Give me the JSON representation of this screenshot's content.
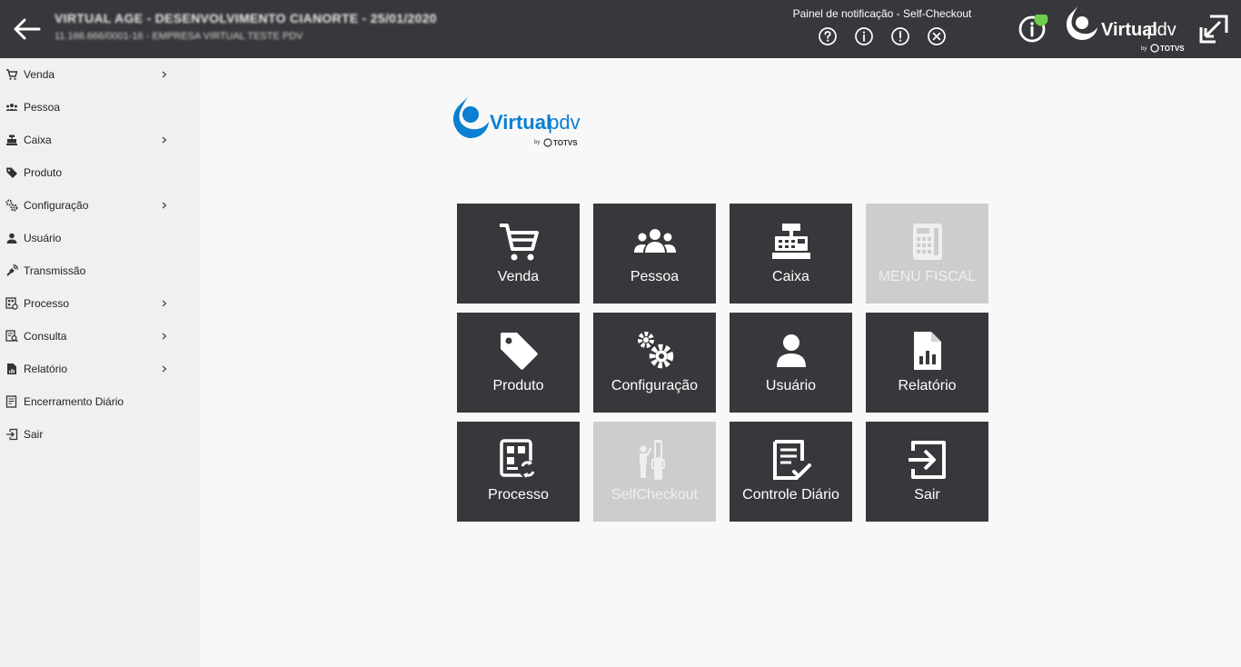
{
  "header": {
    "back_icon": "arrow-left-icon",
    "title": "VIRTUAL AGE - DESENVOLVIMENTO CIANORTE - 25/01/2020",
    "subtitle": "11.166.666/0001-16 - EMPRESA VIRTUAL TESTE PDV",
    "notification_panel_title": "Painel de notificação - Self-Checkout",
    "notification_icons": [
      "help-circle-icon",
      "info-circle-icon",
      "alert-circle-icon",
      "close-circle-icon"
    ],
    "status_icon": "info-status-icon",
    "status_color": "#6ccf4a",
    "expand_icon": "expand-window-icon"
  },
  "logo": {
    "brand": "Virtual",
    "suffix": ".pdv",
    "by": "by",
    "maker": "TOTVS",
    "brand_color": "#0b7fd1"
  },
  "sidebar": {
    "items": [
      {
        "label": "Venda",
        "icon": "cart-icon",
        "has_submenu": true
      },
      {
        "label": "Pessoa",
        "icon": "people-icon",
        "has_submenu": false
      },
      {
        "label": "Caixa",
        "icon": "cash-register-icon",
        "has_submenu": true
      },
      {
        "label": "Produto",
        "icon": "tag-icon",
        "has_submenu": false
      },
      {
        "label": "Configuração",
        "icon": "gears-icon",
        "has_submenu": true
      },
      {
        "label": "Usuário",
        "icon": "user-icon",
        "has_submenu": false
      },
      {
        "label": "Transmissão",
        "icon": "broadcast-icon",
        "has_submenu": false
      },
      {
        "label": "Processo",
        "icon": "process-icon",
        "has_submenu": true
      },
      {
        "label": "Consulta",
        "icon": "search-doc-icon",
        "has_submenu": true
      },
      {
        "label": "Relatório",
        "icon": "report-icon",
        "has_submenu": true
      },
      {
        "label": "Encerramento Diário",
        "icon": "daily-close-icon",
        "has_submenu": false
      },
      {
        "label": "Sair",
        "icon": "exit-icon",
        "has_submenu": false
      }
    ]
  },
  "tiles": [
    {
      "label": "Venda",
      "icon": "cart-icon",
      "enabled": true
    },
    {
      "label": "Pessoa",
      "icon": "people-icon",
      "enabled": true
    },
    {
      "label": "Caixa",
      "icon": "cash-register-icon",
      "enabled": true
    },
    {
      "label": "MENU FISCAL",
      "icon": "fiscal-icon",
      "enabled": false
    },
    {
      "label": "Produto",
      "icon": "tag-icon",
      "enabled": true
    },
    {
      "label": "Configuração",
      "icon": "gears-icon",
      "enabled": true
    },
    {
      "label": "Usuário",
      "icon": "user-icon",
      "enabled": true
    },
    {
      "label": "Relatório",
      "icon": "report-icon",
      "enabled": true
    },
    {
      "label": "Processo",
      "icon": "process-icon",
      "enabled": true
    },
    {
      "label": "SelfCheckout",
      "icon": "self-checkout-icon",
      "enabled": false
    },
    {
      "label": "Controle Diário",
      "icon": "daily-control-icon",
      "enabled": true
    },
    {
      "label": "Sair",
      "icon": "exit-icon",
      "enabled": true
    }
  ],
  "colors": {
    "header_bg": "#37383b",
    "tile_bg": "#37383b",
    "tile_disabled_bg": "#cdcdcd",
    "sidebar_bg": "#f0f0f0",
    "page_bg": "#f8f8f8"
  }
}
